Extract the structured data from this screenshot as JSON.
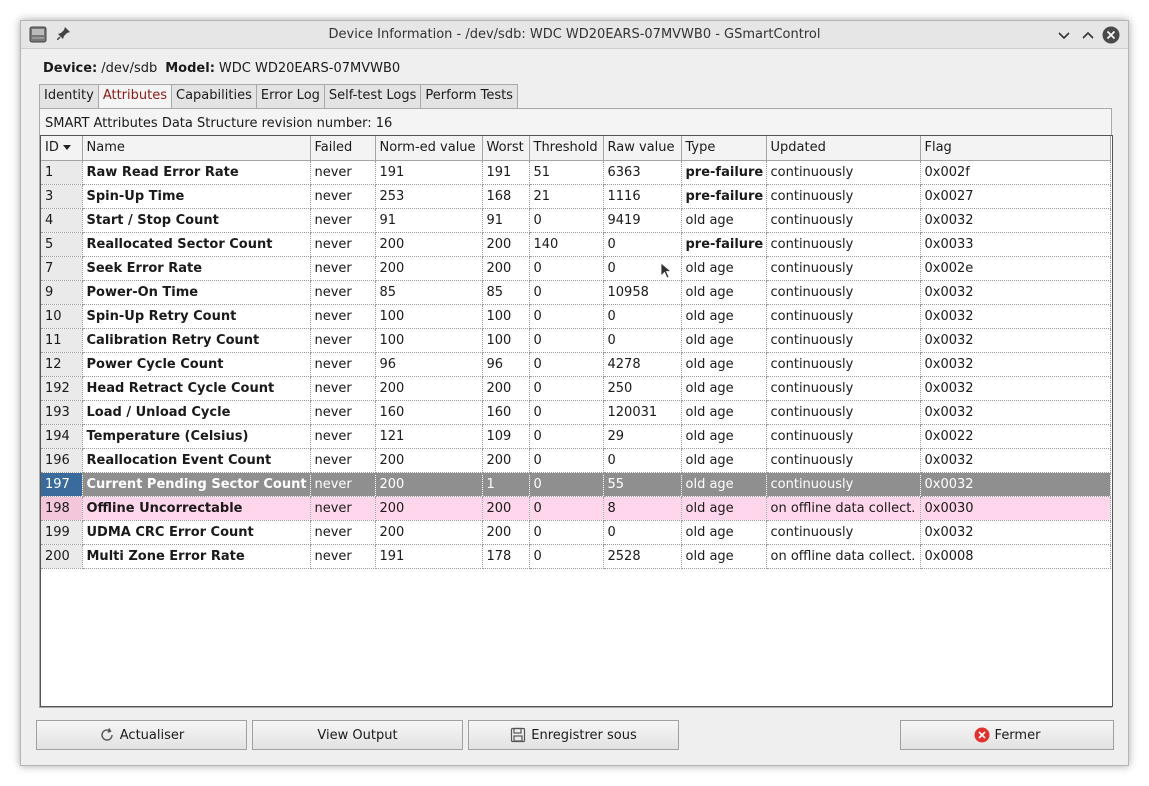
{
  "window": {
    "title": "Device Information - /dev/sdb: WDC WD20EARS-07MVWB0 - GSmartControl",
    "titlebar_icons": [
      "drive-app-icon",
      "pin-icon",
      "minimize-chevron-icon",
      "maximize-chevron-icon",
      "close-circle-icon"
    ]
  },
  "device": {
    "device_label": "Device:",
    "device_value": "/dev/sdb",
    "model_label": "Model:",
    "model_value": "WDC WD20EARS-07MVWB0"
  },
  "tabs": [
    {
      "label": "Identity",
      "active": false
    },
    {
      "label": "Attributes",
      "active": true
    },
    {
      "label": "Capabilities",
      "active": false
    },
    {
      "label": "Error Log",
      "active": false
    },
    {
      "label": "Self-test Logs",
      "active": false
    },
    {
      "label": "Perform Tests",
      "active": false
    }
  ],
  "attributes": {
    "revision_text": "SMART Attributes Data Structure revision number: 16",
    "columns": [
      "ID",
      "Name",
      "Failed",
      "Norm-ed value",
      "Worst",
      "Threshold",
      "Raw value",
      "Type",
      "Updated",
      "Flag"
    ],
    "sort_column": "ID",
    "rows": [
      {
        "id": "1",
        "name": "Raw Read Error Rate",
        "failed": "never",
        "norm": "191",
        "worst": "191",
        "threshold": "51",
        "raw": "6363",
        "type": "pre-failure",
        "updated": "continuously",
        "flag": "0x002f",
        "type_bold": true,
        "state": ""
      },
      {
        "id": "3",
        "name": "Spin-Up Time",
        "failed": "never",
        "norm": "253",
        "worst": "168",
        "threshold": "21",
        "raw": "1116",
        "type": "pre-failure",
        "updated": "continuously",
        "flag": "0x0027",
        "type_bold": true,
        "state": ""
      },
      {
        "id": "4",
        "name": "Start / Stop Count",
        "failed": "never",
        "norm": "91",
        "worst": "91",
        "threshold": "0",
        "raw": "9419",
        "type": "old age",
        "updated": "continuously",
        "flag": "0x0032",
        "type_bold": false,
        "state": ""
      },
      {
        "id": "5",
        "name": "Reallocated Sector Count",
        "failed": "never",
        "norm": "200",
        "worst": "200",
        "threshold": "140",
        "raw": "0",
        "type": "pre-failure",
        "updated": "continuously",
        "flag": "0x0033",
        "type_bold": true,
        "state": ""
      },
      {
        "id": "7",
        "name": "Seek Error Rate",
        "failed": "never",
        "norm": "200",
        "worst": "200",
        "threshold": "0",
        "raw": "0",
        "type": "old age",
        "updated": "continuously",
        "flag": "0x002e",
        "type_bold": false,
        "state": ""
      },
      {
        "id": "9",
        "name": "Power-On Time",
        "failed": "never",
        "norm": "85",
        "worst": "85",
        "threshold": "0",
        "raw": "10958",
        "type": "old age",
        "updated": "continuously",
        "flag": "0x0032",
        "type_bold": false,
        "state": ""
      },
      {
        "id": "10",
        "name": "Spin-Up Retry Count",
        "failed": "never",
        "norm": "100",
        "worst": "100",
        "threshold": "0",
        "raw": "0",
        "type": "old age",
        "updated": "continuously",
        "flag": "0x0032",
        "type_bold": false,
        "state": ""
      },
      {
        "id": "11",
        "name": "Calibration Retry Count",
        "failed": "never",
        "norm": "100",
        "worst": "100",
        "threshold": "0",
        "raw": "0",
        "type": "old age",
        "updated": "continuously",
        "flag": "0x0032",
        "type_bold": false,
        "state": ""
      },
      {
        "id": "12",
        "name": "Power Cycle Count",
        "failed": "never",
        "norm": "96",
        "worst": "96",
        "threshold": "0",
        "raw": "4278",
        "type": "old age",
        "updated": "continuously",
        "flag": "0x0032",
        "type_bold": false,
        "state": ""
      },
      {
        "id": "192",
        "name": "Head Retract Cycle Count",
        "failed": "never",
        "norm": "200",
        "worst": "200",
        "threshold": "0",
        "raw": "250",
        "type": "old age",
        "updated": "continuously",
        "flag": "0x0032",
        "type_bold": false,
        "state": ""
      },
      {
        "id": "193",
        "name": "Load / Unload Cycle",
        "failed": "never",
        "norm": "160",
        "worst": "160",
        "threshold": "0",
        "raw": "120031",
        "type": "old age",
        "updated": "continuously",
        "flag": "0x0032",
        "type_bold": false,
        "state": ""
      },
      {
        "id": "194",
        "name": "Temperature (Celsius)",
        "failed": "never",
        "norm": "121",
        "worst": "109",
        "threshold": "0",
        "raw": "29",
        "type": "old age",
        "updated": "continuously",
        "flag": "0x0022",
        "type_bold": false,
        "state": ""
      },
      {
        "id": "196",
        "name": "Reallocation Event Count",
        "failed": "never",
        "norm": "200",
        "worst": "200",
        "threshold": "0",
        "raw": "0",
        "type": "old age",
        "updated": "continuously",
        "flag": "0x0032",
        "type_bold": false,
        "state": ""
      },
      {
        "id": "197",
        "name": "Current Pending Sector Count",
        "failed": "never",
        "norm": "200",
        "worst": "1",
        "threshold": "0",
        "raw": "55",
        "type": "old age",
        "updated": "continuously",
        "flag": "0x0032",
        "type_bold": false,
        "state": "selected"
      },
      {
        "id": "198",
        "name": "Offline Uncorrectable",
        "failed": "never",
        "norm": "200",
        "worst": "200",
        "threshold": "0",
        "raw": "8",
        "type": "old age",
        "updated": "on offline data collect.",
        "flag": "0x0030",
        "type_bold": false,
        "state": "pink"
      },
      {
        "id": "199",
        "name": "UDMA CRC Error Count",
        "failed": "never",
        "norm": "200",
        "worst": "200",
        "threshold": "0",
        "raw": "0",
        "type": "old age",
        "updated": "continuously",
        "flag": "0x0032",
        "type_bold": false,
        "state": ""
      },
      {
        "id": "200",
        "name": "Multi Zone Error Rate",
        "failed": "never",
        "norm": "191",
        "worst": "178",
        "threshold": "0",
        "raw": "2528",
        "type": "old age",
        "updated": "on offline data collect.",
        "flag": "0x0008",
        "type_bold": false,
        "state": ""
      }
    ]
  },
  "buttons": {
    "refresh": {
      "label": "Actualiser",
      "icon": "refresh-icon"
    },
    "view_output": {
      "label": "View Output"
    },
    "save_as": {
      "label": "Enregistrer sous",
      "icon": "save-icon"
    },
    "close": {
      "label": "Fermer",
      "icon": "close-red-icon"
    }
  },
  "colors": {
    "selected_row": "#8f8f8f",
    "selected_id_cell": "#3a6b9c",
    "warning_row": "#ffd6eb",
    "active_tab_text": "#8b1a1a",
    "close_icon": "#e0312f"
  }
}
